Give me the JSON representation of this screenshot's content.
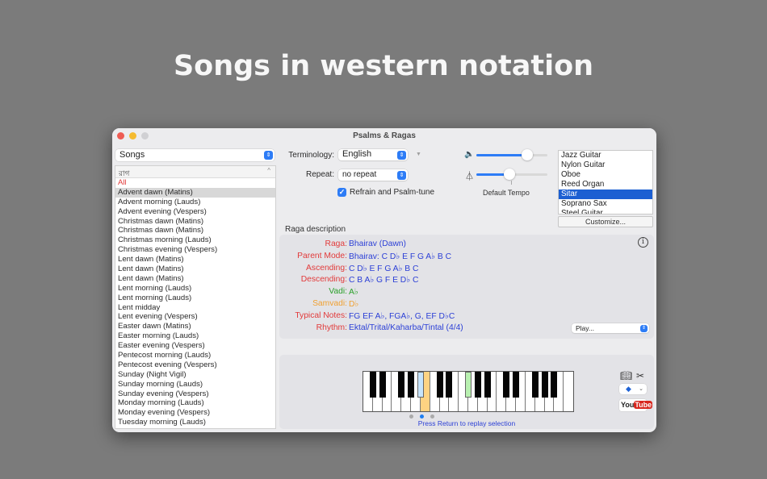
{
  "headline": "Songs in western notation",
  "window": {
    "title": "Psalms & Ragas"
  },
  "left": {
    "category_select": "Songs",
    "list_header": "রাগ",
    "items": [
      {
        "label": "All",
        "red": true,
        "selected": false
      },
      {
        "label": "Advent dawn (Matins)",
        "red": false,
        "selected": true
      },
      {
        "label": "Advent morning (Lauds)"
      },
      {
        "label": "Advent evening (Vespers)"
      },
      {
        "label": "Christmas dawn (Matins)"
      },
      {
        "label": "Christmas dawn (Matins)"
      },
      {
        "label": "Christmas morning (Lauds)"
      },
      {
        "label": "Christmas evening (Vespers)"
      },
      {
        "label": "Lent dawn (Matins)"
      },
      {
        "label": "Lent dawn (Matins)"
      },
      {
        "label": "Lent dawn (Matins)"
      },
      {
        "label": "Lent morning (Lauds)"
      },
      {
        "label": "Lent morning (Lauds)"
      },
      {
        "label": "Lent midday"
      },
      {
        "label": "Lent evening (Vespers)"
      },
      {
        "label": "Easter dawn (Matins)"
      },
      {
        "label": "Easter morning (Lauds)"
      },
      {
        "label": "Easter evening (Vespers)"
      },
      {
        "label": "Pentecost morning (Lauds)"
      },
      {
        "label": "Pentecost evening (Vespers)"
      },
      {
        "label": "Sunday (Night Vigil)"
      },
      {
        "label": "Sunday morning (Lauds)"
      },
      {
        "label": "Sunday evening (Vespers)"
      },
      {
        "label": "Monday morning (Lauds)"
      },
      {
        "label": "Monday evening (Vespers)"
      },
      {
        "label": "Tuesday morning (Lauds)"
      }
    ]
  },
  "controls": {
    "terminology_label": "Terminology:",
    "terminology_value": "English",
    "repeat_label": "Repeat:",
    "repeat_value": "no repeat",
    "refrain_label": "Refrain and Psalm-tune",
    "refrain_checked": true,
    "volume_level": 0.72,
    "tempo_level": 0.47,
    "tempo_label": "Default Tempo"
  },
  "instruments": {
    "items": [
      "Jazz Guitar",
      "Nylon Guitar",
      "Oboe",
      "Reed Organ",
      "Sitar",
      "Soprano Sax",
      "Steel Guitar"
    ],
    "selected": "Sitar",
    "customize_label": "Customize..."
  },
  "raga": {
    "section_title": "Raga description",
    "rows": [
      {
        "key": "Raga:",
        "value": "Bhairav (Dawn)",
        "key_color": "#e23a3a",
        "value_color": "#2b3fd6"
      },
      {
        "key": "Parent Mode:",
        "value": "Bhairav: C D♭ E F G A♭ B C",
        "key_color": "#e23a3a",
        "value_color": "#2b3fd6"
      },
      {
        "key": "Ascending:",
        "value": "C D♭ E F G A♭ B C",
        "key_color": "#e23a3a",
        "value_color": "#2b3fd6"
      },
      {
        "key": "Descending:",
        "value": "C B A♭ G F E D♭ C",
        "key_color": "#e23a3a",
        "value_color": "#2b3fd6"
      },
      {
        "key": "Vadi:",
        "value": "A♭",
        "key_color": "#2aa02a",
        "value_color": "#2aa02a"
      },
      {
        "key": "Samvadi:",
        "value": "D♭",
        "key_color": "#f0a030",
        "value_color": "#f0a030"
      },
      {
        "key": "Typical Notes:",
        "value": "FG EF A♭, FGA♭, G, EF D♭C",
        "key_color": "#e23a3a",
        "value_color": "#2b3fd6"
      },
      {
        "key": "Rhythm:",
        "value": "Ektal/Trital/Kaharba/Tintal (4/4)",
        "key_color": "#e23a3a",
        "value_color": "#2b3fd6"
      }
    ],
    "play_select": "Play..."
  },
  "keyboard": {
    "white_keys": 22,
    "black_key_slots": [
      1,
      2,
      4,
      5,
      6,
      8,
      9,
      11,
      12,
      13,
      15,
      16,
      18,
      19,
      20
    ],
    "highlighted": [
      {
        "type": "black",
        "slot": 6,
        "color": "#c6e4fb"
      },
      {
        "type": "white",
        "index": 6,
        "color": "#fdd382"
      },
      {
        "type": "black",
        "slot": 11,
        "color": "#b8f0b0"
      }
    ],
    "page_dots": 3,
    "active_dot": 1,
    "hint": "Press Return to replay selection"
  },
  "side": {
    "youtube_you": "You",
    "youtube_tube": "Tube"
  }
}
